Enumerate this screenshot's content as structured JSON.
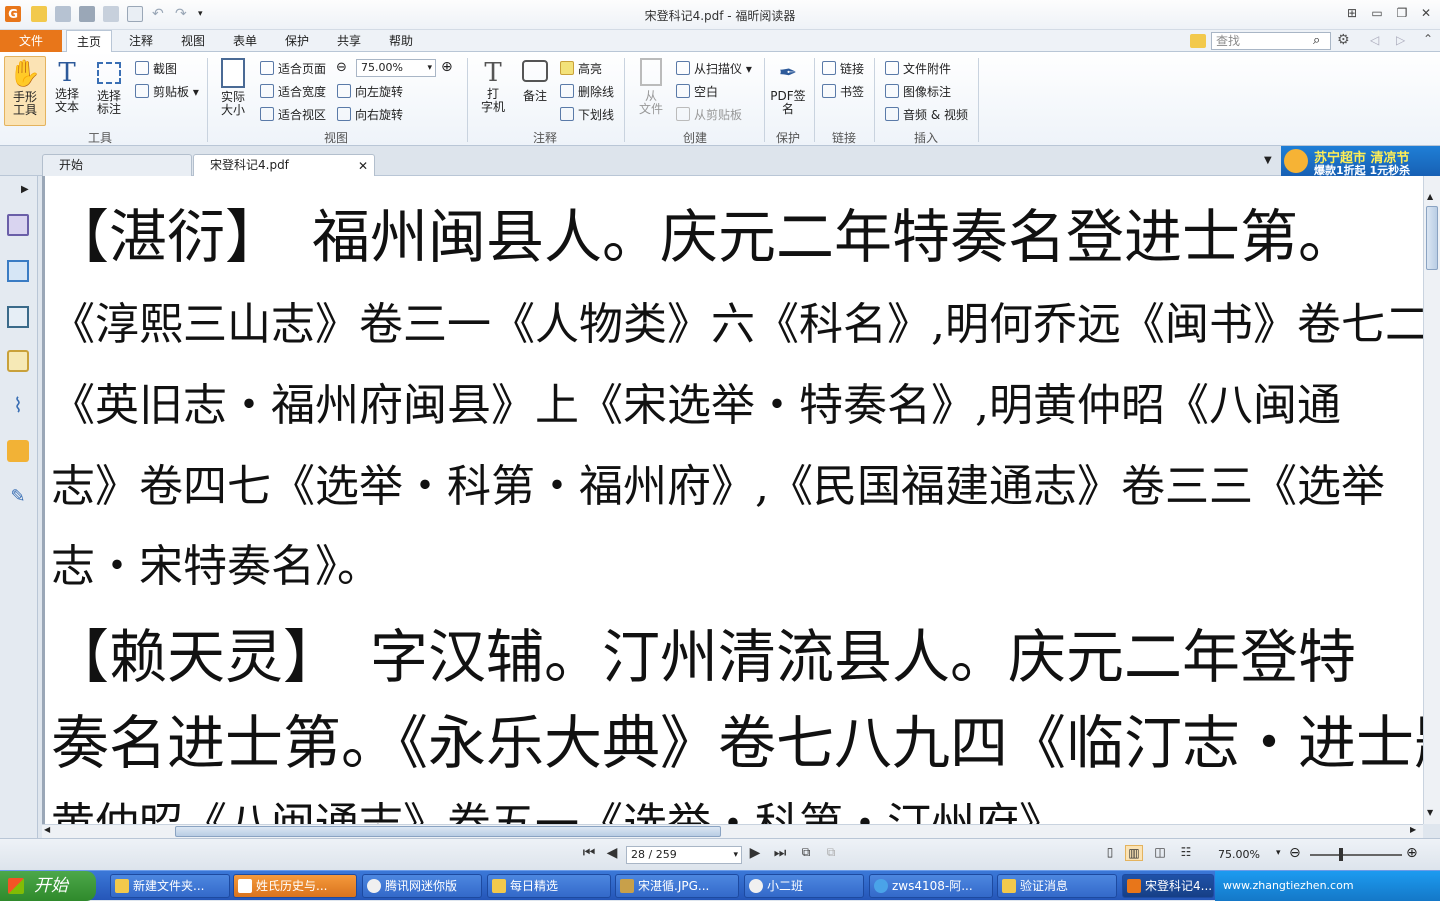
{
  "app": {
    "title": "宋登科记4.pdf - 福昕阅读器"
  },
  "menu": {
    "tabs": [
      "文件",
      "主页",
      "注释",
      "视图",
      "表单",
      "保护",
      "共享",
      "帮助"
    ],
    "search_placeholder": "查找"
  },
  "ribbon": {
    "tools": {
      "hand": "手形\n工具",
      "select_text": "选择\n文本",
      "select_annot": "选择\n标注",
      "screenshot": "截图",
      "clipboard": "剪贴板",
      "group": "工具"
    },
    "view": {
      "actual_size": "实际\n大小",
      "fit_page": "适合页面",
      "fit_width": "适合宽度",
      "fit_visible": "适合视区",
      "zoom": "75.00%",
      "rotate_left": "向左旋转",
      "rotate_right": "向右旋转",
      "group": "视图"
    },
    "comment": {
      "typewriter": "打\n字机",
      "note": "备注",
      "highlight": "高亮",
      "strikeout": "删除线",
      "underline": "下划线",
      "group": "注释"
    },
    "create": {
      "from_file": "从\n文件",
      "from_scanner": "从扫描仪",
      "blank": "空白",
      "from_clipboard": "从剪贴板",
      "group": "创建"
    },
    "protect": {
      "pdf_sign": "PDF签\n名",
      "group": "保护"
    },
    "links": {
      "link": "链接",
      "bookmark": "书签",
      "group": "链接"
    },
    "insert": {
      "attachment": "文件附件",
      "image": "图像标注",
      "media": "音频 & 视频",
      "group": "插入"
    }
  },
  "doctabs": {
    "start": "开始",
    "current": "宋登科记4.pdf",
    "ad_line1": "苏宁超市 清凉节",
    "ad_line2": "爆款1折起 1元秒杀"
  },
  "document": {
    "lines": [
      "【湛衍】　福州闽县人。庆元二年特奏名登进士第。",
      "《淳熙三山志》卷三一《人物类》六《科名》,明何乔远《闽书》卷七二",
      "《英旧志・福州府闽县》上《宋选举・特奏名》,明黄仲昭《八闽通",
      "志》卷四七《选举・科第・福州府》,《民国福建通志》卷三三《选举",
      "志・宋特奏名》。",
      "【赖天灵】　字汉辅。汀州清流县人。庆元二年登特",
      "奏名进士第。《永乐大典》卷七八九四《临汀志・进士题名》,明",
      "黄仲昭《八闽通志》卷五一《选举・科第・汀州府》"
    ]
  },
  "status": {
    "page": "28 / 259",
    "zoom": "75.00%"
  },
  "taskbar": {
    "start": "开始",
    "items": [
      "新建文件夹...",
      "姓氏历史与...",
      "腾讯网迷你版",
      "每日精选",
      "宋湛循.JPG...",
      "小二班",
      "zws4108-阿...",
      "验证消息",
      "宋登科记4..."
    ],
    "tray": "www.zhangtiezhen.com"
  },
  "colors": {
    "accent": "#e8761a",
    "taskbar": "#2556b8",
    "start": "#3a9a37"
  }
}
